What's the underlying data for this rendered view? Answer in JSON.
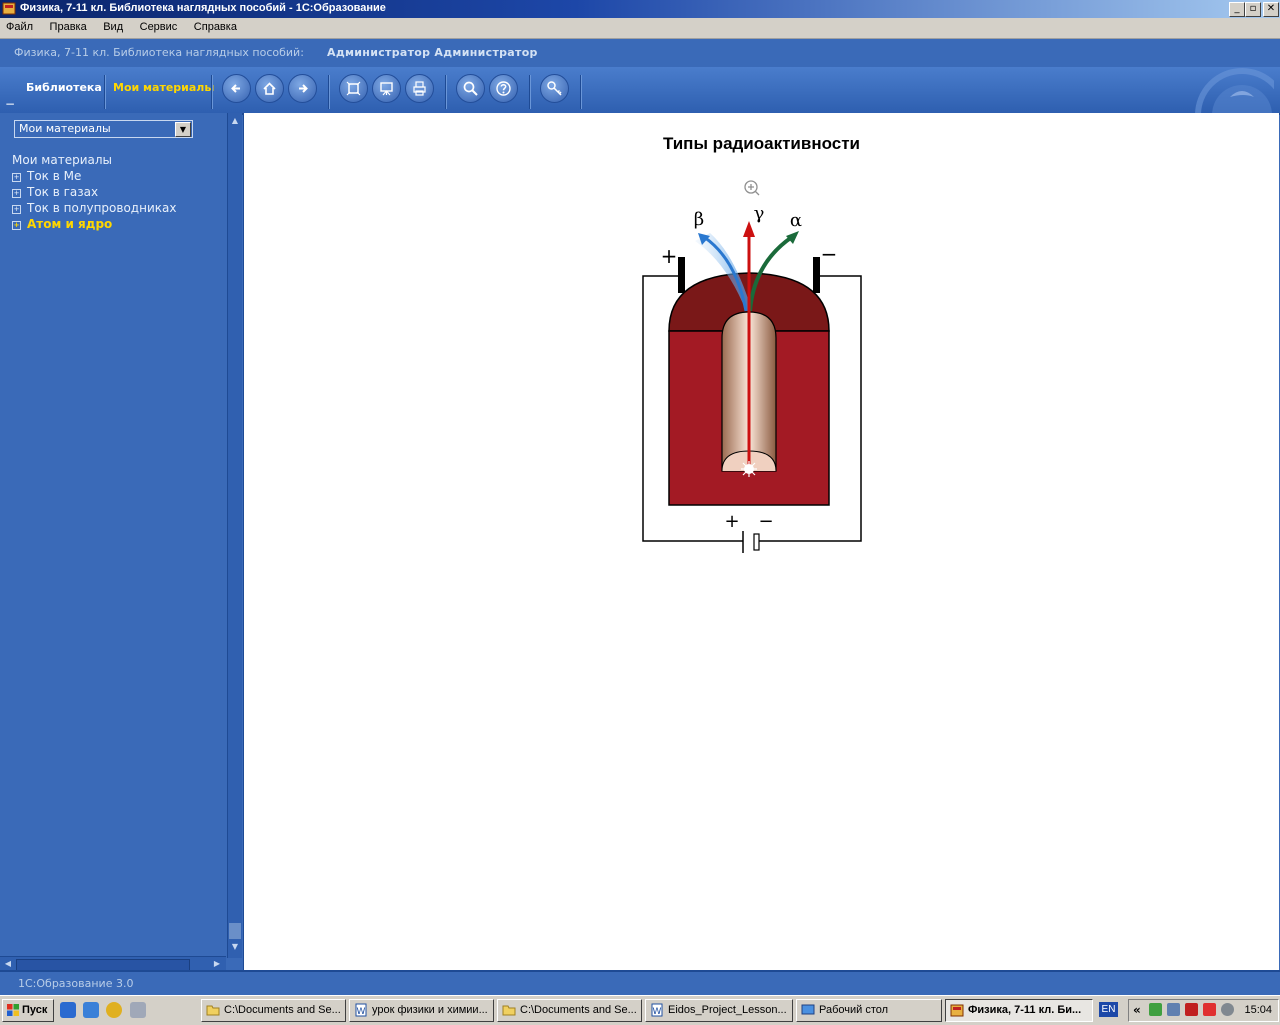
{
  "window": {
    "title": "Физика, 7-11 кл. Библиотека наглядных пособий - 1С:Образование",
    "buttons": [
      "_",
      "▫",
      "✕"
    ]
  },
  "menu": [
    "Файл",
    "Правка",
    "Вид",
    "Сервис",
    "Справка"
  ],
  "header": {
    "product": "Физика, 7-11 кл. Библиотека наглядных пособий:",
    "user": "Администратор Администратор"
  },
  "toolbar": {
    "tab_library": "Библиотека",
    "tab_my_materials": "Мои материалы",
    "collapse_glyph": "−",
    "icons": [
      "back-arrow-icon",
      "home-icon",
      "forward-arrow-icon",
      "fullscreen-icon",
      "presentation-icon",
      "print-icon",
      "search-icon",
      "help-icon",
      "key-icon"
    ]
  },
  "sidebar": {
    "select_value": "Мои материалы",
    "select_arrow": "▼",
    "tree_title": "Мои материалы",
    "items": [
      {
        "label": "Ток в Ме",
        "expander": "+"
      },
      {
        "label": "Ток в газах",
        "expander": "+"
      },
      {
        "label": "Ток в полупроводниках",
        "expander": "+"
      },
      {
        "label": "Атом и ядро",
        "expander": "+",
        "active": true
      }
    ],
    "scroll_up": "▲",
    "scroll_down": "▼",
    "scroll_left": "◀",
    "scroll_right": "▶"
  },
  "content": {
    "title": "Типы радиоактивности",
    "figure": {
      "ray_labels": {
        "beta": "β",
        "gamma": "γ",
        "alpha": "α"
      },
      "plate_signs": {
        "left": "+",
        "right": "−"
      },
      "battery_signs": {
        "plus": "+",
        "minus": "−"
      }
    }
  },
  "status": {
    "text": "1С:Образование 3.0"
  },
  "taskbar": {
    "start": "Пуск",
    "tasks": [
      {
        "label": "C:\\Documents and Se..."
      },
      {
        "label": "урок физики и химии..."
      },
      {
        "label": "C:\\Documents and Se..."
      },
      {
        "label": "Eidos_Project_Lesson..."
      },
      {
        "label": "Рабочий стол"
      },
      {
        "label": "Физика, 7-11 кл. Би...",
        "active": true
      }
    ],
    "lang": "EN",
    "tray_chevron": "«",
    "clock": "15:04"
  },
  "colors": {
    "accent": "#3a6ab8",
    "active_item": "#ffd700",
    "chamber": "#a31a24"
  }
}
